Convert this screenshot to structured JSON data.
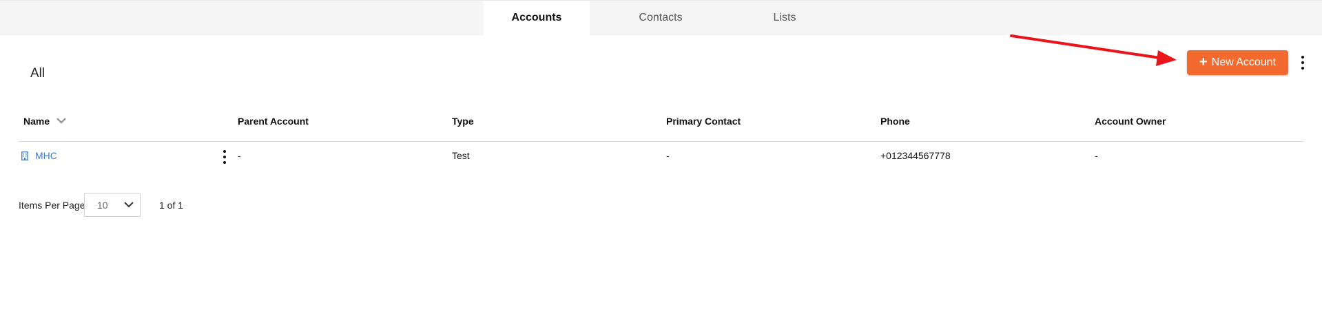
{
  "tabs": [
    {
      "label": "Accounts",
      "active": true
    },
    {
      "label": "Contacts",
      "active": false
    },
    {
      "label": "Lists",
      "active": false
    }
  ],
  "view": {
    "title": "All"
  },
  "new_button": {
    "label": "New Account",
    "icon": "plus-icon",
    "color": "#f26a2e"
  },
  "table": {
    "columns": [
      "Name",
      "Parent Account",
      "Type",
      "Primary Contact",
      "Phone",
      "Account Owner"
    ],
    "rows": [
      {
        "name": "MHC",
        "parent_account": "-",
        "type": "Test",
        "primary_contact": "-",
        "phone": "+012344567778",
        "account_owner": "-"
      }
    ]
  },
  "pagination": {
    "items_per_page_label": "Items Per Page",
    "items_per_page_value": "10",
    "page_info": "1 of 1"
  },
  "colors": {
    "link": "#3d7bbf",
    "annotation_arrow": "#e8151b"
  }
}
